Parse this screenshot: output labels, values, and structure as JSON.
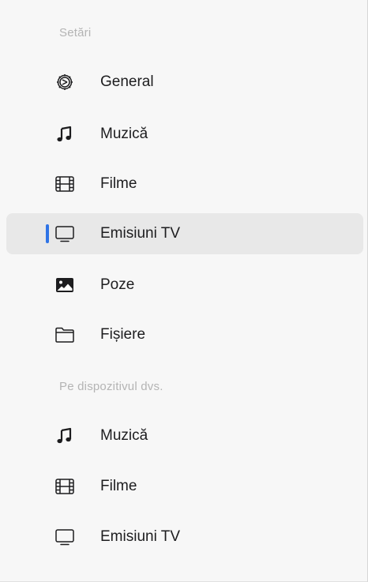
{
  "sidebar": {
    "sections": [
      {
        "header": "Setări",
        "items": [
          {
            "label": "General",
            "icon": "gear-icon",
            "selected": false
          },
          {
            "label": "Muzică",
            "icon": "music-note-icon",
            "selected": false
          },
          {
            "label": "Filme",
            "icon": "film-icon",
            "selected": false
          },
          {
            "label": "Emisiuni TV",
            "icon": "tv-icon",
            "selected": true
          },
          {
            "label": "Poze",
            "icon": "photo-icon",
            "selected": false
          },
          {
            "label": "Fișiere",
            "icon": "folder-icon",
            "selected": false
          }
        ]
      },
      {
        "header": "Pe dispozitivul dvs.",
        "items": [
          {
            "label": "Muzică",
            "icon": "music-note-icon",
            "selected": false
          },
          {
            "label": "Filme",
            "icon": "film-icon",
            "selected": false
          },
          {
            "label": "Emisiuni TV",
            "icon": "tv-icon",
            "selected": false
          }
        ]
      }
    ]
  },
  "colors": {
    "accent": "#2f74e6",
    "selected_background": "#e8e8e8",
    "header_text": "#b4b4b4",
    "item_text": "#1d1d1f"
  }
}
